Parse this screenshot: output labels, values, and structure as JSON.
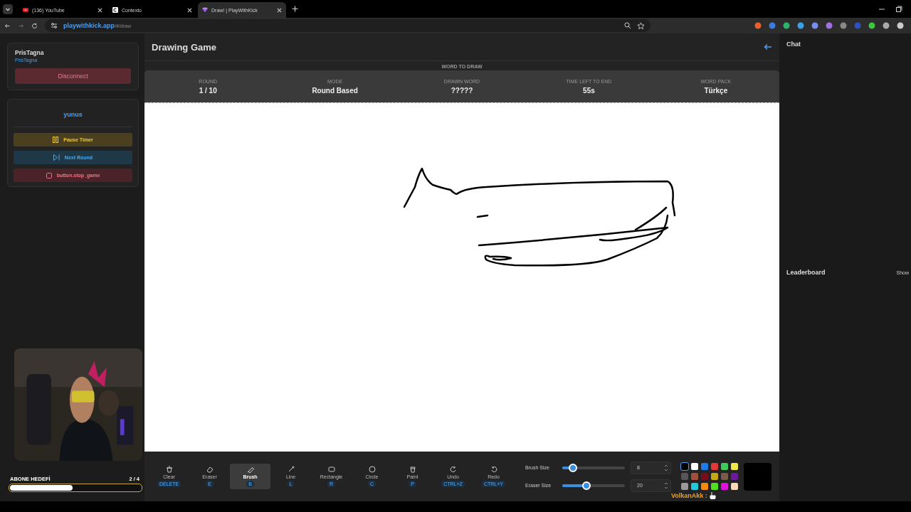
{
  "browser": {
    "tabs": [
      {
        "title": "(136) YouTube",
        "selected": false
      },
      {
        "title": "Contexto",
        "selected": false
      },
      {
        "title": "Draw! | PlayWithKick",
        "selected": true
      }
    ],
    "url_host": "playwithkick.app",
    "url_path": "/#/draw"
  },
  "sidebar": {
    "user": {
      "name": "PrisTagna",
      "handle": "PrisTagna"
    },
    "disconnect": "Disconnect",
    "host": "yunus",
    "buttons": [
      {
        "label": "Pause Timer",
        "kind": "pause"
      },
      {
        "label": "Next Round",
        "kind": "next"
      },
      {
        "label": "button.stop_game",
        "kind": "stop"
      }
    ]
  },
  "game": {
    "title": "Drawing Game",
    "word_to_draw": "WORD TO DRAW",
    "stats": [
      {
        "label": "ROUND",
        "value": "1 / 10"
      },
      {
        "label": "MODE",
        "value": "Round Based"
      },
      {
        "label": "DRAWN WORD",
        "value": "?????"
      },
      {
        "label": "TIME LEFT TO END",
        "value": "55s"
      },
      {
        "label": "WORD PACK",
        "value": "Türkçe"
      }
    ]
  },
  "toolbar": {
    "tools": [
      {
        "label": "Clear",
        "shortcut": "DELETE",
        "kind": "clear",
        "selected": false
      },
      {
        "label": "Eraser",
        "shortcut": "E",
        "kind": "eraser",
        "selected": false
      },
      {
        "label": "Brush",
        "shortcut": "B",
        "kind": "brush",
        "selected": true
      },
      {
        "label": "Line",
        "shortcut": "L",
        "kind": "line",
        "selected": false
      },
      {
        "label": "Rectangle",
        "shortcut": "R",
        "kind": "rectangle",
        "selected": false
      },
      {
        "label": "Circle",
        "shortcut": "C",
        "kind": "circle",
        "selected": false
      },
      {
        "label": "Paint",
        "shortcut": "P",
        "kind": "paint",
        "selected": false
      },
      {
        "label": "Undo",
        "shortcut": "CTRL+Z",
        "kind": "undo",
        "selected": false
      },
      {
        "label": "Redo",
        "shortcut": "CTRL+Y",
        "kind": "redo",
        "selected": false
      }
    ],
    "sliders": [
      {
        "label": "Brush Size",
        "level": 0.17,
        "value": "8"
      },
      {
        "label": "Eraser Size",
        "level": 0.39,
        "value": "20"
      }
    ],
    "colors": [
      {
        "color": "#000000",
        "selected": true
      },
      {
        "color": "#ffffff",
        "selected": false
      },
      {
        "color": "#1e7be8",
        "selected": false
      },
      {
        "color": "#e03a3a",
        "selected": false
      },
      {
        "color": "#3dcc5c",
        "selected": false
      },
      {
        "color": "#f0e84a",
        "selected": false
      },
      {
        "color": "#555555",
        "selected": false
      },
      {
        "color": "#a0503c",
        "selected": false
      },
      {
        "color": "#7a0c1c",
        "selected": false
      },
      {
        "color": "#c8a810",
        "selected": false
      },
      {
        "color": "#7a5a48",
        "selected": false
      },
      {
        "color": "#6a1a9a",
        "selected": false
      },
      {
        "color": "#999999",
        "selected": false
      },
      {
        "color": "#20c8d8",
        "selected": false
      },
      {
        "color": "#f08c10",
        "selected": false
      },
      {
        "color": "#50e020",
        "selected": false
      },
      {
        "color": "#e010e0",
        "selected": false
      },
      {
        "color": "#f8d8b8",
        "selected": false
      }
    ]
  },
  "chat": {
    "title": "Chat"
  },
  "leaderboard": {
    "title": "Leaderboard",
    "toggle": "Show"
  },
  "stream_overlay": {
    "goal": {
      "title": "ABONE HEDEFİ",
      "level": 0.48,
      "count": "2 / 4"
    },
    "chat_message": "VolkanAkk :"
  }
}
